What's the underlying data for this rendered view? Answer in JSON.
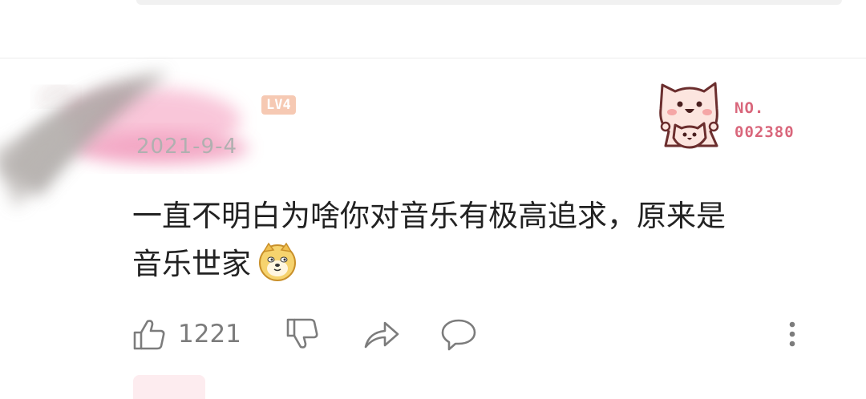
{
  "header": {
    "level_badge": "LV4",
    "date": "2021-9-4"
  },
  "fan_badge": {
    "icon": "cat-mascot-icon",
    "label": "NO.",
    "number": "002380",
    "color": "#d9667b"
  },
  "comment": {
    "text_line1": "一直不明白为啥你对音乐有极高追求，原来是",
    "text_line2": "音乐世家",
    "emoji": "doge-emoji"
  },
  "actions": {
    "like_icon": "thumbs-up-icon",
    "like_count": "1221",
    "dislike_icon": "thumbs-down-icon",
    "share_icon": "share-icon",
    "reply_icon": "comment-icon",
    "more_icon": "more-vertical-icon"
  },
  "colors": {
    "text": "#222222",
    "muted": "#7c7c7c",
    "accent_pink": "#f3a6c3"
  }
}
